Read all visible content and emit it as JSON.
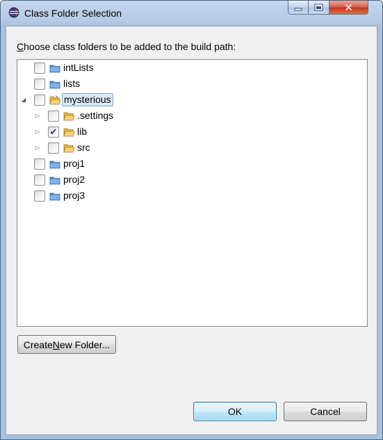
{
  "window": {
    "title": "Class Folder Selection",
    "minimize_glyph": "–",
    "maximize_glyph": "□",
    "close_glyph": "✕"
  },
  "prompt": {
    "mnemonic": "C",
    "rest": "hoose class folders to be added to the build path:"
  },
  "tree": {
    "items": [
      {
        "label": "intLists",
        "checked": false,
        "icon": "folder-icon",
        "expandable": false,
        "expanded": false,
        "depth": 0
      },
      {
        "label": "lists",
        "checked": false,
        "icon": "folder-icon",
        "expandable": false,
        "expanded": false,
        "depth": 0
      },
      {
        "label": "mysterious",
        "checked": false,
        "icon": "open-folder-icon",
        "expandable": true,
        "expanded": true,
        "depth": 0,
        "selected": true
      },
      {
        "label": ".settings",
        "checked": false,
        "icon": "package-folder-icon",
        "expandable": true,
        "expanded": false,
        "depth": 1
      },
      {
        "label": "lib",
        "checked": true,
        "icon": "package-folder-icon",
        "expandable": true,
        "expanded": false,
        "depth": 1
      },
      {
        "label": "src",
        "checked": false,
        "icon": "package-folder-icon",
        "expandable": true,
        "expanded": false,
        "depth": 1
      },
      {
        "label": "proj1",
        "checked": false,
        "icon": "folder-icon",
        "expandable": false,
        "expanded": false,
        "depth": 0
      },
      {
        "label": "proj2",
        "checked": false,
        "icon": "folder-icon",
        "expandable": false,
        "expanded": false,
        "depth": 0
      },
      {
        "label": "proj3",
        "checked": false,
        "icon": "folder-icon",
        "expandable": false,
        "expanded": false,
        "depth": 0
      }
    ]
  },
  "buttons": {
    "create_prefix": "Create ",
    "create_mnemonic": "N",
    "create_suffix": "ew Folder...",
    "ok": "OK",
    "cancel": "Cancel"
  },
  "glyphs": {
    "expanded": "◢",
    "collapsed": "▷",
    "check": "✔"
  },
  "colors": {
    "folder_blue": "#4f86c6",
    "folder_yellow": "#e8b84a",
    "selection_bg": "#dcebfc",
    "close_red": "#c2351c"
  }
}
